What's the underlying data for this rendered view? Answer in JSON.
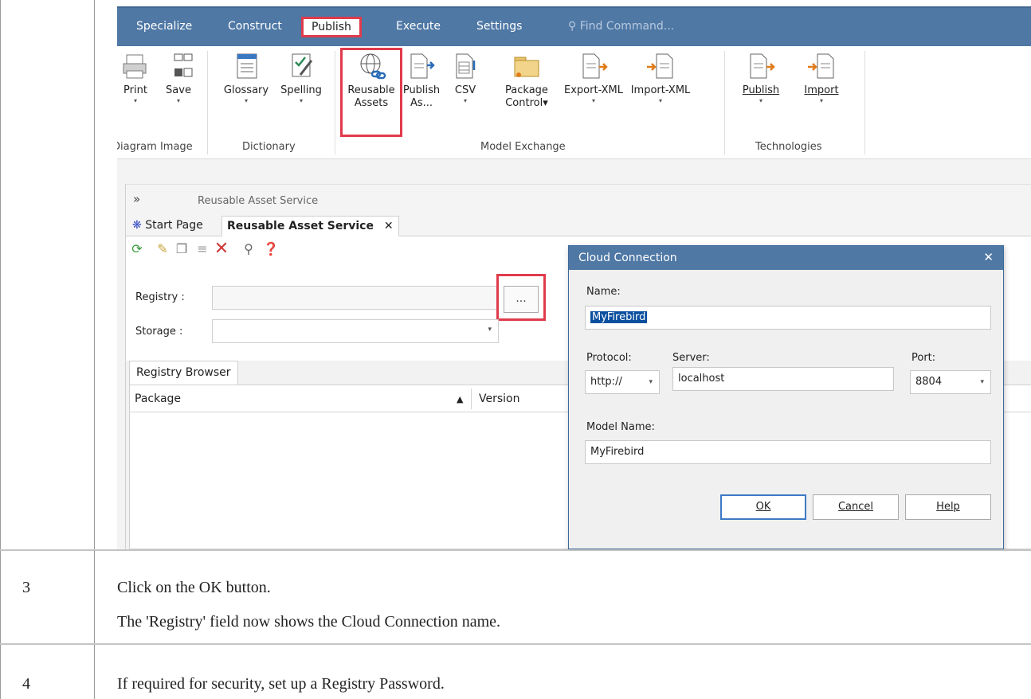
{
  "menu": {
    "items": [
      "Specialize",
      "Construct",
      "Publish",
      "Execute",
      "Settings"
    ],
    "find_command": "Find Command..."
  },
  "ribbon": {
    "print": {
      "line1": "Print",
      "line2": "▾"
    },
    "save": {
      "line1": "Save",
      "line2": "▾"
    },
    "glossary": {
      "line1": "Glossary",
      "line2": "▾"
    },
    "spelling": {
      "line1": "Spelling",
      "line2": "▾"
    },
    "reusable_assets": {
      "line1": "Reusable",
      "line2": "Assets"
    },
    "publish_as": {
      "line1": "Publish",
      "line2": "As..."
    },
    "csv": {
      "line1": "CSV",
      "line2": "▾"
    },
    "package_control": {
      "line1": "Package",
      "line2": "Control▾"
    },
    "export_xml": {
      "line1": "Export-XML",
      "line2": "▾"
    },
    "import_xml": {
      "line1": "Import-XML",
      "line2": "▾"
    },
    "tech_publish": {
      "line1": "Publish",
      "line2": "▾"
    },
    "tech_import": {
      "line1": "Import",
      "line2": "▾"
    },
    "groups": {
      "diagram_image": "Diagram Image",
      "dictionary": "Dictionary",
      "model_exchange": "Model Exchange",
      "technologies": "Technologies"
    }
  },
  "window": {
    "chevron": "»",
    "title": "Reusable Asset Service",
    "tabs": {
      "start_page": "Start Page",
      "ras": "Reusable Asset Service",
      "close": "✕"
    },
    "registry_label": "Registry :",
    "storage_label": "Storage :",
    "dots": "...",
    "storage_arrow": "▾",
    "subtab": "Registry Browser",
    "col_package": "Package",
    "col_sort": "▲",
    "col_version": "Version"
  },
  "dialog": {
    "title": "Cloud Connection",
    "close": "✕",
    "name_label": "Name:",
    "name_value": "MyFirebird",
    "protocol_label": "Protocol:",
    "protocol_value": "http://",
    "server_label": "Server:",
    "server_value": "localhost",
    "port_label": "Port:",
    "port_value": "8804",
    "model_label": "Model Name:",
    "model_value": "MyFirebird",
    "ok": "OK",
    "cancel": "Cancel",
    "help": "Help",
    "arrow": "▾"
  },
  "steps": [
    {
      "num": "3",
      "lines": [
        "Click on the OK button.",
        "The 'Registry' field now shows the Cloud Connection name."
      ]
    },
    {
      "num": "4",
      "lines": [
        "If required for security, set up a Registry Password."
      ]
    }
  ],
  "colors": {
    "accent_red": "#e03b4b",
    "title_blue": "#4f78a5"
  }
}
